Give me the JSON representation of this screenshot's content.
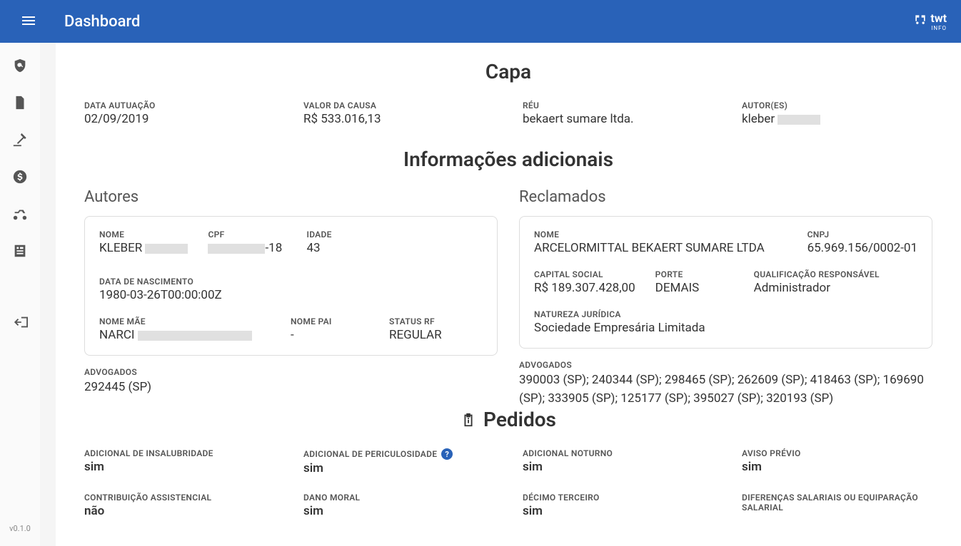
{
  "header": {
    "title": "Dashboard",
    "logo_text": "twt",
    "logo_sub": "INFO"
  },
  "version": "v0.1.0",
  "capa": {
    "title": "Capa",
    "fields": [
      {
        "label": "DATA AUTUAÇÃO",
        "value": "02/09/2019"
      },
      {
        "label": "VALOR DA CAUSA",
        "value": "R$ 533.016,13"
      },
      {
        "label": "RÉU",
        "value": "bekaert sumare ltda."
      },
      {
        "label": "AUTOR(ES)",
        "value": "kleber"
      }
    ]
  },
  "info": {
    "title": "Informações adicionais",
    "autores": {
      "title": "Autores",
      "fields": [
        {
          "label": "NOME",
          "value": "KLEBER"
        },
        {
          "label": "CPF",
          "value": "-18"
        },
        {
          "label": "IDADE",
          "value": "43"
        },
        {
          "label": "DATA DE NASCIMENTO",
          "value": "1980-03-26T00:00:00Z"
        },
        {
          "label": "NOME MÃE",
          "value": "NARCI"
        },
        {
          "label": "NOME PAI",
          "value": "-"
        },
        {
          "label": "STATUS RF",
          "value": "REGULAR"
        }
      ],
      "advogados": {
        "label": "ADVOGADOS",
        "value": "292445 (SP)"
      }
    },
    "reclamados": {
      "title": "Reclamados",
      "fields": [
        {
          "label": "NOME",
          "value": "ARCELORMITTAL BEKAERT SUMARE LTDA"
        },
        {
          "label": "CNPJ",
          "value": "65.969.156/0002-01"
        },
        {
          "label": "CAPITAL SOCIAL",
          "value": "R$ 189.307.428,00"
        },
        {
          "label": "PORTE",
          "value": "DEMAIS"
        },
        {
          "label": "QUALIFICAÇÃO RESPONSÁVEL",
          "value": "Administrador"
        },
        {
          "label": "NATUREZA JURÍDICA",
          "value": "Sociedade Empresária Limitada"
        }
      ],
      "advogados": {
        "label": "ADVOGADOS",
        "value": "390003 (SP); 240344 (SP); 298465 (SP); 262609 (SP); 418463 (SP); 169690 (SP); 333905 (SP); 125177 (SP); 395027 (SP); 320193 (SP)"
      }
    }
  },
  "pedidos": {
    "title": "Pedidos",
    "items": [
      {
        "label": "ADICIONAL DE INSALUBRIDADE",
        "value": "sim",
        "help": false
      },
      {
        "label": "ADICIONAL DE PERICULOSIDADE",
        "value": "sim",
        "help": true
      },
      {
        "label": "ADICIONAL NOTURNO",
        "value": "sim",
        "help": false
      },
      {
        "label": "AVISO PRÉVIO",
        "value": "sim",
        "help": false
      },
      {
        "label": "CONTRIBUIÇÃO ASSISTENCIAL",
        "value": "não",
        "help": false
      },
      {
        "label": "DANO MORAL",
        "value": "sim",
        "help": false
      },
      {
        "label": "DÉCIMO TERCEIRO",
        "value": "sim",
        "help": false
      },
      {
        "label": "DIFERENÇAS SALARIAIS OU EQUIPARAÇÃO SALARIAL",
        "value": "",
        "help": false
      }
    ]
  }
}
